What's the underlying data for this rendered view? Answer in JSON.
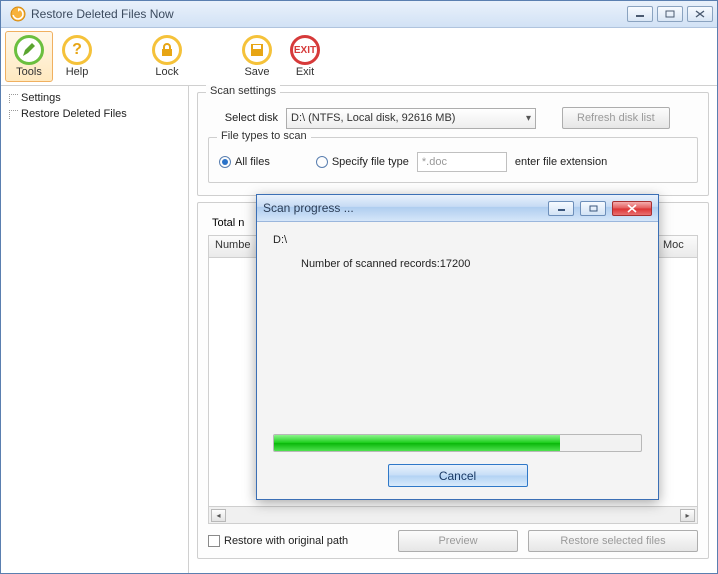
{
  "window": {
    "title": "Restore Deleted Files Now"
  },
  "toolbar": {
    "tools": "Tools",
    "help": "Help",
    "lock": "Lock",
    "save": "Save",
    "exit": "Exit"
  },
  "sidebar": {
    "items": [
      {
        "label": "Settings"
      },
      {
        "label": "Restore Deleted Files"
      }
    ]
  },
  "scan_settings": {
    "legend": "Scan settings",
    "select_disk_label": "Select disk",
    "selected_disk": "D:\\  (NTFS, Local disk, 92616 MB)",
    "refresh_btn": "Refresh disk list",
    "file_types_legend": "File types to scan",
    "all_files": "All files",
    "specify": "Specify file type",
    "ext_placeholder": "*.doc",
    "ext_hint": "enter file extension"
  },
  "results": {
    "total_label": "Total n",
    "columns": {
      "number": "Numbe",
      "mod": "Moc"
    },
    "restore_original": "Restore with original path",
    "preview_btn": "Preview",
    "restore_btn": "Restore selected files"
  },
  "dialog": {
    "title": "Scan progress ...",
    "disk": "D:\\",
    "records_label": "Number of scanned records:",
    "records_value": "17200",
    "cancel": "Cancel",
    "progress_pct": 78
  }
}
